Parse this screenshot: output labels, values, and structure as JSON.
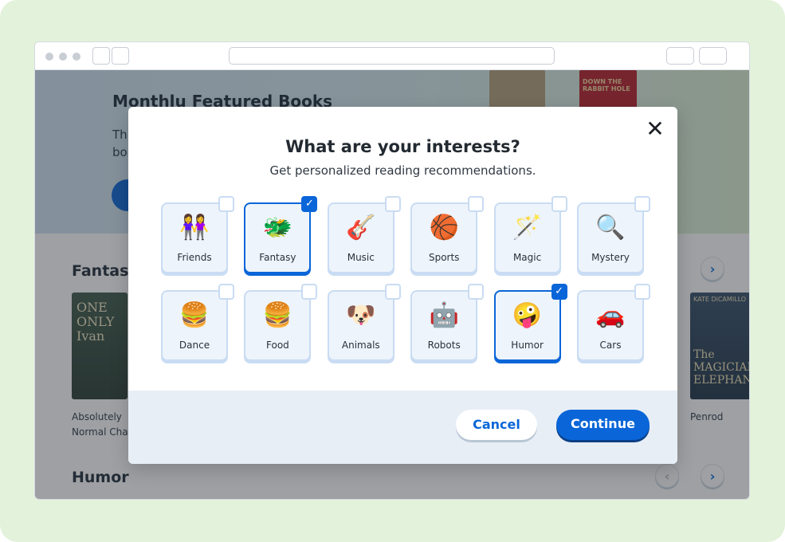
{
  "page": {
    "hero_title": "Monthlu Featured Books",
    "hero_text": "Thi bo",
    "hero_book_text": "DOWN THE RABBIT HOLE",
    "section_fantasy": "Fantasy",
    "section_humor": "Humor",
    "book1_cover_text": "ONE ONLY Ivan",
    "book1_title": "Absolutely Normal Chao",
    "book2_cover_author": "KATE DiCAMILLO",
    "book2_cover_text": "The MAGICIAN ELEPHANT",
    "book2_title": "Penrod"
  },
  "modal": {
    "title": "What are your interests?",
    "subtitle": "Get personalized reading recommendations.",
    "close": "✕",
    "cancel_label": "Cancel",
    "continue_label": "Continue",
    "interests": [
      {
        "label": "Friends",
        "emoji": "👭",
        "selected": false
      },
      {
        "label": "Fantasy",
        "emoji": "🐲",
        "selected": true
      },
      {
        "label": "Music",
        "emoji": "🎸",
        "selected": false
      },
      {
        "label": "Sports",
        "emoji": "🏀",
        "selected": false
      },
      {
        "label": "Magic",
        "emoji": "🪄",
        "selected": false
      },
      {
        "label": "Mystery",
        "emoji": "🔍",
        "selected": false
      },
      {
        "label": "Dance",
        "emoji": "🍔",
        "selected": false
      },
      {
        "label": "Food",
        "emoji": "🍔",
        "selected": false
      },
      {
        "label": "Animals",
        "emoji": "🐶",
        "selected": false
      },
      {
        "label": "Robots",
        "emoji": "🤖",
        "selected": false
      },
      {
        "label": "Humor",
        "emoji": "🤪",
        "selected": true
      },
      {
        "label": "Cars",
        "emoji": "🚗",
        "selected": false
      }
    ]
  },
  "colors": {
    "accent": "#0a66d8",
    "card_bg": "#eef4fb",
    "card_border": "#c9dcf3"
  }
}
